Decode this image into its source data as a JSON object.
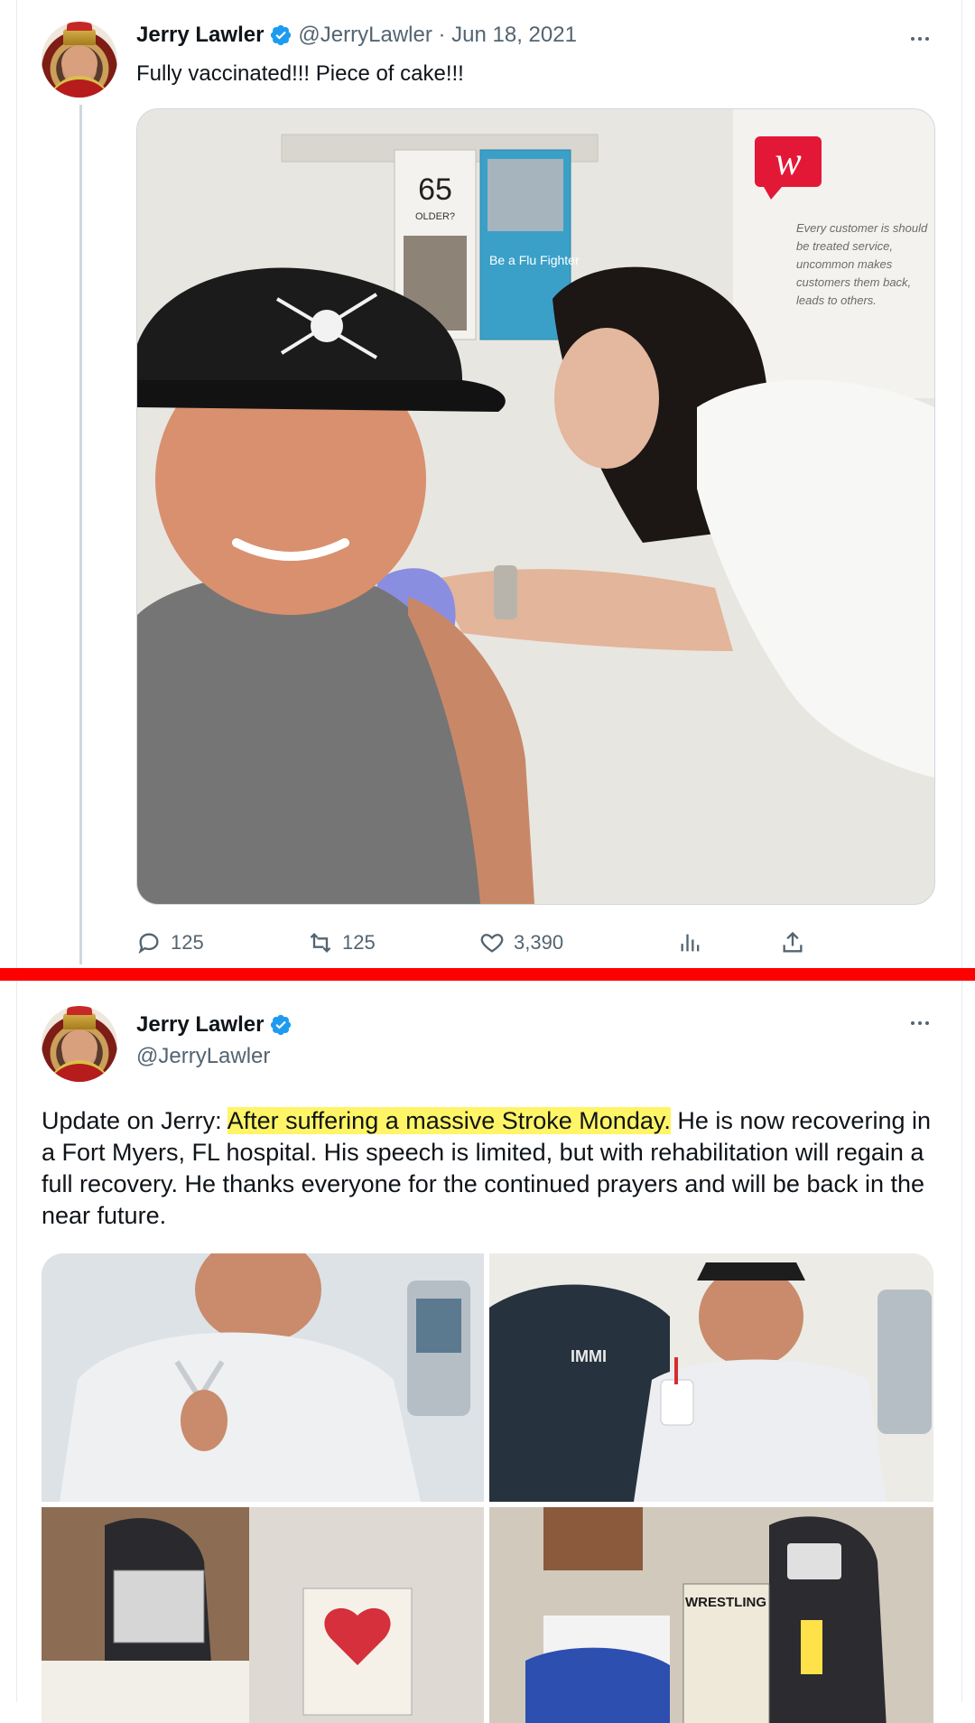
{
  "colors": {
    "accent": "#1d9bf0",
    "divider": "#ff0000",
    "text": "#0f1419",
    "muted": "#536471",
    "highlight": "#fff566"
  },
  "tweet1": {
    "author": {
      "display_name": "Jerry Lawler",
      "handle": "@JerryLawler",
      "verified": true,
      "avatar_icon": "profile-avatar"
    },
    "meta": "@JerryLawler · Jun 18, 2021",
    "text": "Fully vaccinated!!! Piece of cake!!!",
    "media": {
      "poster_text": "65",
      "poster_subtext": "OLDER?",
      "brochure_text": "Be a Flu Fighter",
      "logo_text": "w",
      "sign_text": "Every customer is should be treated service, uncommon makes customers them back, leads to others."
    },
    "actions": {
      "reply_count": "125",
      "retweet_count": "125",
      "like_count": "3,390"
    }
  },
  "tweet2": {
    "author": {
      "display_name": "Jerry Lawler",
      "handle": "@JerryLawler",
      "verified": true,
      "avatar_icon": "profile-avatar"
    },
    "text_prefix": "Update on Jerry: ",
    "text_highlight": "After suffering a massive Stroke Monday.",
    "text_suffix": " He is now recovering in a Fort Myers, FL hospital. His speech is limited, but with rehabilitation will regain a full recovery. He thanks everyone for the continued  prayers and will be back in the near future.",
    "media": {
      "shirt_text": "IMMI",
      "poster_title": "WRESTLING"
    }
  }
}
